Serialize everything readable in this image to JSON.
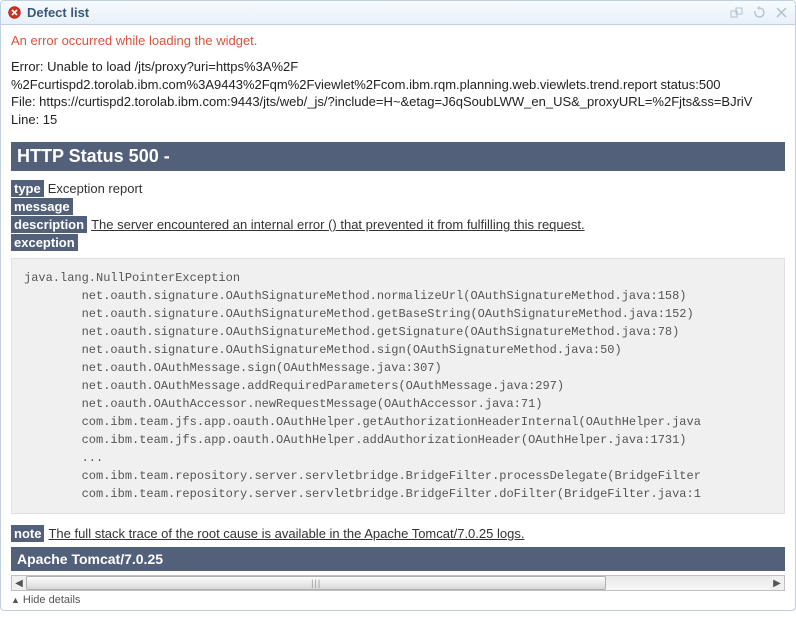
{
  "titlebar": {
    "title": "Defect list"
  },
  "error": {
    "message": "An error occurred while loading the widget.",
    "line1": "Error: Unable to load /jts/proxy?uri=https%3A%2F",
    "line2": "%2Fcurtispd2.torolab.ibm.com%3A9443%2Fqm%2Fviewlet%2Fcom.ibm.rqm.planning.web.viewlets.trend.report status:500",
    "line3": "File: https://curtispd2.torolab.ibm.com:9443/jts/web/_js/?include=H~&etag=J6qSoubLWW_en_US&_proxyURL=%2Fjts&ss=BJriV",
    "line4": "Line: 15"
  },
  "http": {
    "status_title": "HTTP Status 500 -",
    "type_label": "type",
    "type_value": "Exception report",
    "message_label": "message",
    "description_label": "description",
    "description_value": "The server encountered an internal error () that prevented it from fulfilling this request.",
    "exception_label": "exception",
    "note_label": "note",
    "note_value": "The full stack trace of the root cause is available in the Apache Tomcat/7.0.25 logs.",
    "tomcat": "Apache Tomcat/7.0.25"
  },
  "stack": {
    "text": "java.lang.NullPointerException\n\tnet.oauth.signature.OAuthSignatureMethod.normalizeUrl(OAuthSignatureMethod.java:158)\n\tnet.oauth.signature.OAuthSignatureMethod.getBaseString(OAuthSignatureMethod.java:152)\n\tnet.oauth.signature.OAuthSignatureMethod.getSignature(OAuthSignatureMethod.java:78)\n\tnet.oauth.signature.OAuthSignatureMethod.sign(OAuthSignatureMethod.java:50)\n\tnet.oauth.OAuthMessage.sign(OAuthMessage.java:307)\n\tnet.oauth.OAuthMessage.addRequiredParameters(OAuthMessage.java:297)\n\tnet.oauth.OAuthAccessor.newRequestMessage(OAuthAccessor.java:71)\n\tcom.ibm.team.jfs.app.oauth.OAuthHelper.getAuthorizationHeaderInternal(OAuthHelper.java\n\tcom.ibm.team.jfs.app.oauth.OAuthHelper.addAuthorizationHeader(OAuthHelper.java:1731)\n\t...\n\tcom.ibm.team.repository.server.servletbridge.BridgeFilter.processDelegate(BridgeFilter\n\tcom.ibm.team.repository.server.servletbridge.BridgeFilter.doFilter(BridgeFilter.java:1"
  },
  "footer": {
    "hide_details": "Hide details"
  }
}
